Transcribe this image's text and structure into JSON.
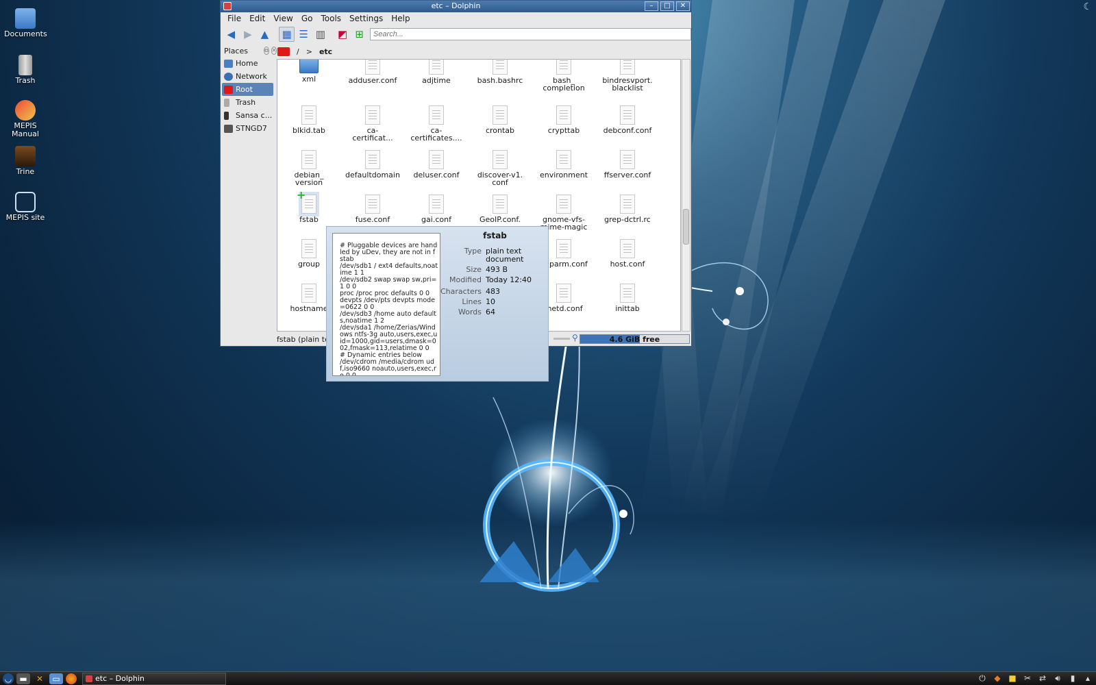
{
  "desktop": {
    "icons": [
      {
        "label": "Documents",
        "icon": "documents-folder-icon"
      },
      {
        "label": "Trash",
        "icon": "trash-icon"
      },
      {
        "label": "MEPIS Manual",
        "icon": "manual-icon"
      },
      {
        "label": "Trine",
        "icon": "game-icon"
      },
      {
        "label": "MEPIS site",
        "icon": "globe-icon"
      }
    ]
  },
  "window": {
    "title": "etc – Dolphin",
    "buttons": {
      "minimize": "–",
      "maximize": "□",
      "close": "✕"
    },
    "menu": [
      "File",
      "Edit",
      "View",
      "Go",
      "Tools",
      "Settings",
      "Help"
    ],
    "search": {
      "placeholder": "Search...",
      "value": ""
    },
    "places": {
      "title": "Places",
      "items": [
        {
          "label": "Home",
          "icon": "home-icon"
        },
        {
          "label": "Network",
          "icon": "network-icon"
        },
        {
          "label": "Root",
          "icon": "root-folder-icon",
          "selected": true
        },
        {
          "label": "Trash",
          "icon": "trash-icon"
        },
        {
          "label": "Sansa c...",
          "icon": "device-icon"
        },
        {
          "label": "STNGD7",
          "icon": "drive-icon"
        }
      ]
    },
    "breadcrumb": {
      "root": "/",
      "sep": ">",
      "current": "etc"
    },
    "files": [
      [
        "xml",
        "adduser.conf",
        "adjtime",
        "bash.bashrc",
        "bash_\ncompletion",
        "bindresvport.\nblacklist"
      ],
      [
        "blkid.tab",
        "ca-\ncertificat...",
        "ca-\ncertificates....",
        "crontab",
        "crypttab",
        "debconf.conf"
      ],
      [
        "debian_\nversion",
        "defaultdomain",
        "deluser.conf",
        "discover-v1.\nconf",
        "environment",
        "ffserver.conf"
      ],
      [
        "fstab",
        "fuse.conf",
        "gai.conf",
        "GeoIP.conf.\n",
        "gnome-vfs-\nmime-magic",
        "grep-dctrl.rc"
      ],
      [
        "group",
        "",
        "",
        "",
        "hdparm.conf",
        "host.conf"
      ],
      [
        "hostname",
        "",
        "",
        "",
        "inetd.conf",
        "inittab"
      ]
    ],
    "status": {
      "text": "fstab (plain tex",
      "free_label": "4.6 GiB free",
      "used_fraction": 0.55
    }
  },
  "tooltip": {
    "name": "fstab",
    "preview": "# Pluggable devices are handled by uDev, they are not in fstab\n/dev/sdb1 / ext4 defaults,noatime 1 1\n/dev/sdb2 swap swap sw,pri=1 0 0\nproc /proc proc defaults 0 0\ndevpts /dev/pts devpts mode=0622 0 0\n/dev/sdb3 /home auto defaults,noatime 1 2\n/dev/sda1 /home/Zerias/Windows ntfs-3g auto,users,exec,uid=1000,gid=users,dmask=002,fmask=113,relatime 0 0\n# Dynamic entries below\n/dev/cdrom /media/cdrom udf,iso9660 noauto,users,exec,ro 0 0",
    "rows": [
      {
        "key": "Type",
        "value": "plain text document"
      },
      {
        "key": "Size",
        "value": "493 B"
      },
      {
        "key": "Modified",
        "value": "Today 12:40"
      },
      {
        "key": "Characters",
        "value": "483"
      },
      {
        "key": "Lines",
        "value": "10"
      },
      {
        "key": "Words",
        "value": "64"
      }
    ]
  },
  "taskbar": {
    "task_label": "etc – Dolphin",
    "launchers": [
      "kmenu-icon",
      "show-desktop-icon",
      "tools-icon",
      "file-manager-icon",
      "firefox-icon"
    ],
    "tray": [
      "power-icon",
      "updater-icon",
      "notes-icon",
      "clipboard-icon",
      "network-icon",
      "volume-icon",
      "battery-icon",
      "arrow-up-icon"
    ]
  }
}
